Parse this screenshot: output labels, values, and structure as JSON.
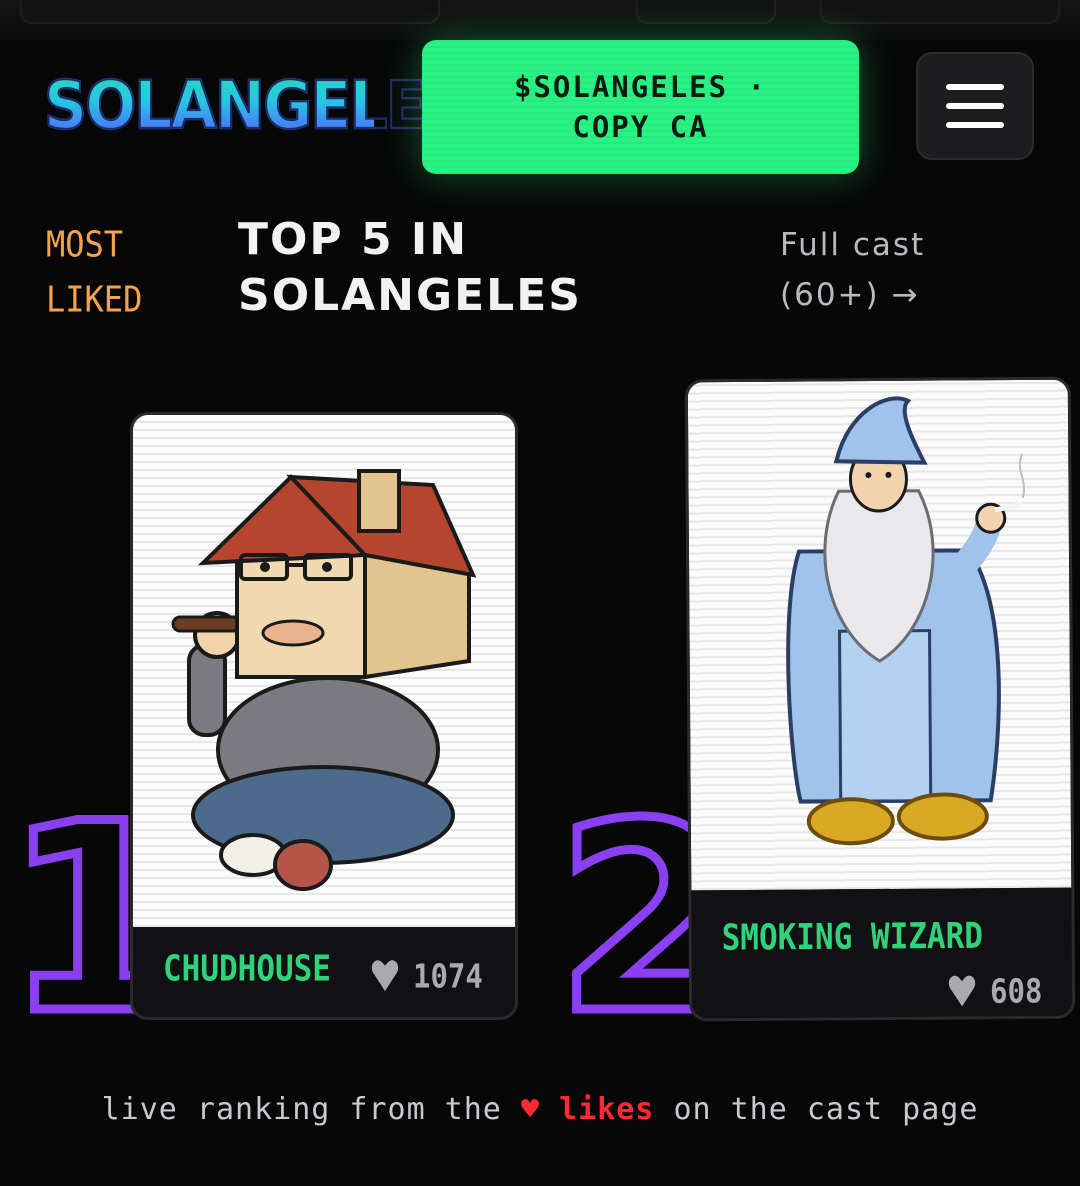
{
  "header": {
    "logo_text": "SOLANGELES",
    "ca_button_label": "$SOLANGELES · COPY CA",
    "menu_icon": "hamburger-menu-icon"
  },
  "section": {
    "eyebrow": "MOST LIKED",
    "title": "TOP 5 IN SOLANGELES",
    "full_cast_link": "Full cast (60+) →"
  },
  "ranking": [
    {
      "rank": "1",
      "name": "CHUDHOUSE",
      "likes": "1074",
      "image": "house-headed man smoking cigar illustration"
    },
    {
      "rank": "2",
      "name": "SMOKING WIZARD",
      "likes": "608",
      "image": "wizard in blue robe smoking cigarette illustration"
    }
  ],
  "footer": {
    "caption_before": "live ranking from the",
    "caption_heart": "♥",
    "caption_likes": "likes",
    "caption_after": "on the cast page"
  },
  "colors": {
    "background": "#070708",
    "accent_green": "#2af282",
    "rank_purple": "#8a3ff0",
    "eyebrow_orange": "#f3a34c",
    "name_green": "#2fd37c",
    "heart_red": "#ff2a33"
  }
}
